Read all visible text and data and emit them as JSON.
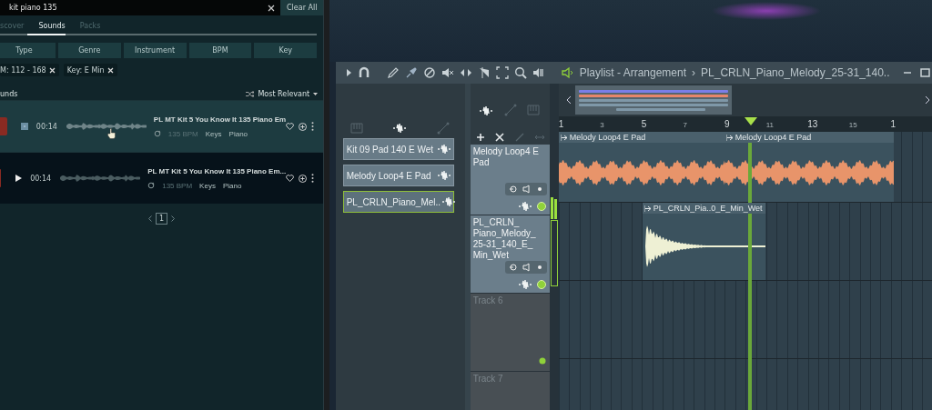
{
  "search": {
    "query": "kit piano 135",
    "clear_label": "Clear All"
  },
  "tabs": [
    {
      "label": "scover",
      "selected": false
    },
    {
      "label": "Sounds",
      "selected": true
    },
    {
      "label": "Packs",
      "selected": false
    }
  ],
  "filters": [
    "Type",
    "Genre",
    "Instrument",
    "BPM",
    "Key"
  ],
  "chips": [
    "M: 112 - 168",
    "Key: E Min"
  ],
  "results": {
    "heading": "unds",
    "sort": "Most Relevant"
  },
  "sounds": [
    {
      "selected": true,
      "playing": true,
      "duration": "00:14",
      "title": "PL MT Kit 5 You Know It 135 Piano Em",
      "bpm": "135 BPM",
      "tags": [
        "Keys",
        "Piano"
      ]
    },
    {
      "selected": false,
      "playing": false,
      "duration": "00:14",
      "title": "PL MT Kit 5 You Know It 135 Piano Em...",
      "bpm": "135 BPM",
      "tags": [
        "Keys",
        "Piano"
      ]
    }
  ],
  "pagination": {
    "page": "1"
  },
  "playlist": {
    "title": "Playlist - Arrangement",
    "separator": "›",
    "pattern": "PL_CRLN_Piano_Melody_25-31_140..",
    "ruler": [
      "1",
      "3",
      "5",
      "7",
      "9",
      "11",
      "13",
      "15",
      "1"
    ],
    "picker": [
      {
        "label": "Kit 09 Pad 140 E Wet",
        "selected": false
      },
      {
        "label": "Melody Loop4 E Pad",
        "selected": false
      },
      {
        "label": "PL_CRLN_Piano_Mel..",
        "selected": true
      }
    ],
    "tracks": [
      {
        "kind": "audio",
        "name": "Melody Loop4 E Pad",
        "clips": [
          "Melody Loop4 E Pad",
          "Melody Loop4 E Pad"
        ]
      },
      {
        "kind": "audio",
        "name": "PL_CRLN_Piano_Melody_25-31_140_E_Min_Wet",
        "clips": [
          "PL_CRLN_Pia..0_E_Min_Wet"
        ]
      },
      {
        "kind": "empty",
        "name": "Track 6"
      },
      {
        "kind": "empty",
        "name": "Track 7"
      }
    ]
  }
}
